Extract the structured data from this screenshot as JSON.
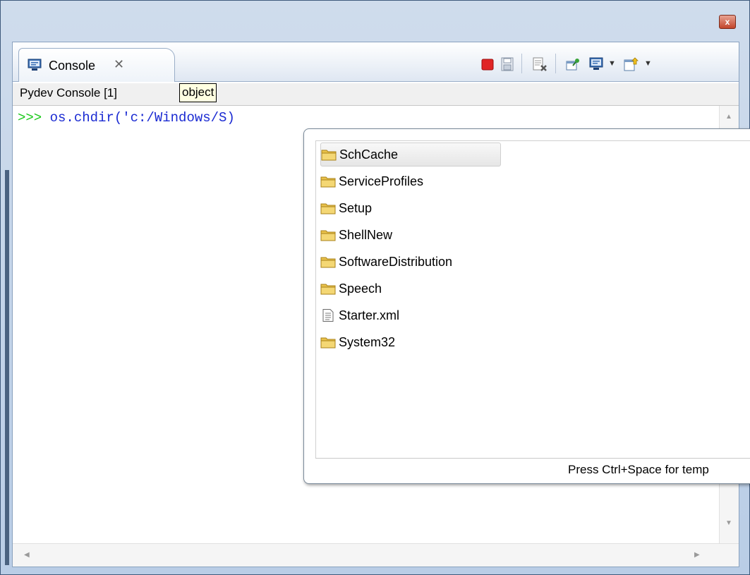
{
  "window": {
    "close_glyph": "x"
  },
  "tab": {
    "label": "Console",
    "close_glyph": "✕",
    "icon": "console-icon"
  },
  "toolbar": {
    "icons": [
      "terminate-icon",
      "save-icon",
      "clear-console-icon",
      "pin-console-icon",
      "display-console-icon",
      "open-console-icon"
    ]
  },
  "info": {
    "console_name": "Pydev Console [1]",
    "tooltip": "object"
  },
  "console": {
    "prompt": ">>> ",
    "code": "os.chdir('c:/Windows/S)"
  },
  "completion": {
    "items": [
      {
        "label": "SchCache",
        "type": "folder",
        "selected": true
      },
      {
        "label": "ServiceProfiles",
        "type": "folder"
      },
      {
        "label": "Setup",
        "type": "folder"
      },
      {
        "label": "ShellNew",
        "type": "folder"
      },
      {
        "label": "SoftwareDistribution",
        "type": "folder"
      },
      {
        "label": "Speech",
        "type": "folder"
      },
      {
        "label": "Starter.xml",
        "type": "file"
      },
      {
        "label": "System32",
        "type": "folder"
      }
    ],
    "status": "Press Ctrl+Space for temp"
  },
  "colors": {
    "prompt": "#18c818",
    "code": "#1a2ad2",
    "folder": "#e9c14a"
  }
}
